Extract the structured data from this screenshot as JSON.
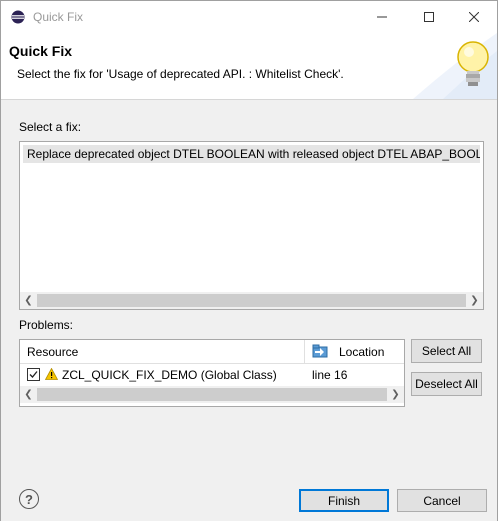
{
  "window": {
    "title": "Quick Fix"
  },
  "header": {
    "title": "Quick Fix",
    "message": "Select the fix for 'Usage of deprecated API.  : Whitelist Check'."
  },
  "fixes": {
    "label": "Select a fix:",
    "items": [
      "Replace deprecated object DTEL BOOLEAN with released object DTEL ABAP_BOOLEAN"
    ]
  },
  "problems": {
    "label": "Problems:",
    "columns": {
      "resource": "Resource",
      "location": "Location"
    },
    "rows": [
      {
        "checked": true,
        "resource": "ZCL_QUICK_FIX_DEMO (Global Class)",
        "location": "line 16"
      }
    ]
  },
  "buttons": {
    "select_all": "Select All",
    "deselect_all": "Deselect All",
    "finish": "Finish",
    "cancel": "Cancel"
  },
  "colors": {
    "accent": "#0078d7",
    "selection": "#e5e5e5",
    "dialog_bg": "#f0f0f0",
    "warning": "#f0c000"
  }
}
